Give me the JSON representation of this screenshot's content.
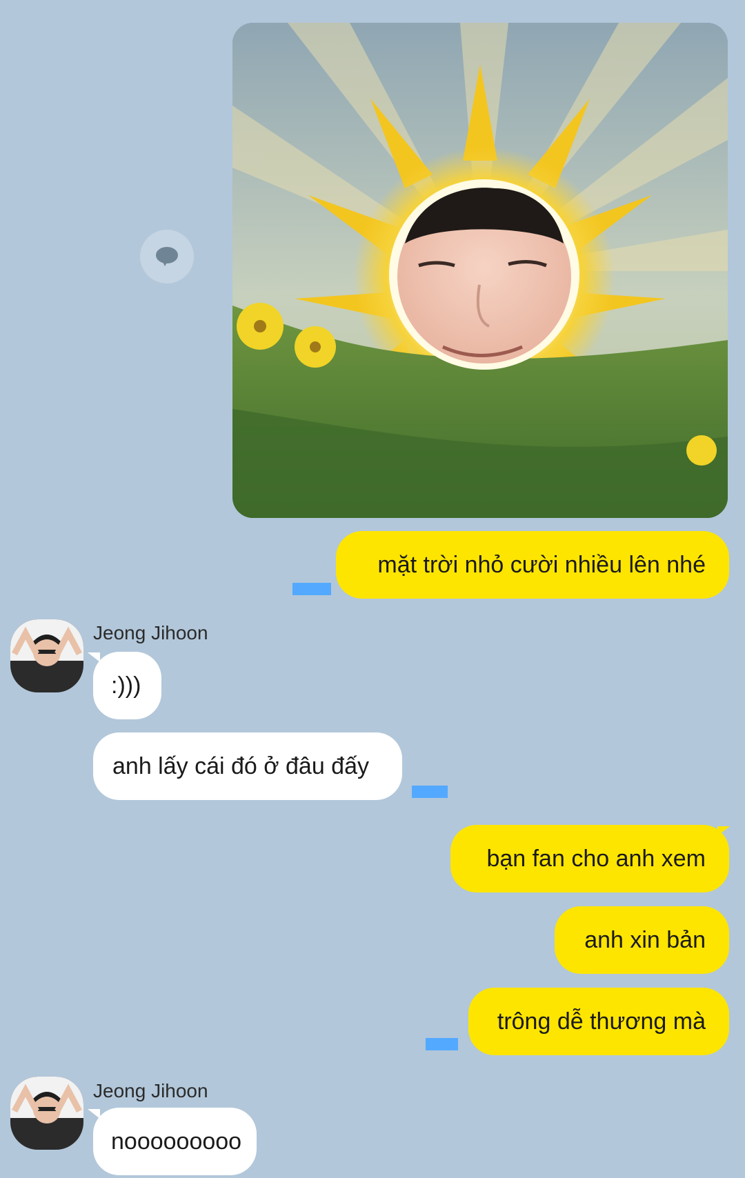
{
  "messages": {
    "m1_text": "mặt trời nhỏ cười nhiều lên nhé",
    "m2_text": ":)))",
    "m3_text": "anh lấy cái đó ở đâu đấy",
    "m4_text": "bạn fan cho anh xem",
    "m5_text": "anh xin bản",
    "m6_text": "trông dễ thương mà",
    "m7_text": "nooooooooo"
  },
  "contact": {
    "name": "Jeong Jihoon"
  },
  "colors": {
    "background": "#b2c7da",
    "my_bubble": "#fee500",
    "their_bubble": "#ffffff",
    "timestamp_redaction": "#53a9ff"
  },
  "icons": {
    "share": "speech-bubble-icon"
  }
}
